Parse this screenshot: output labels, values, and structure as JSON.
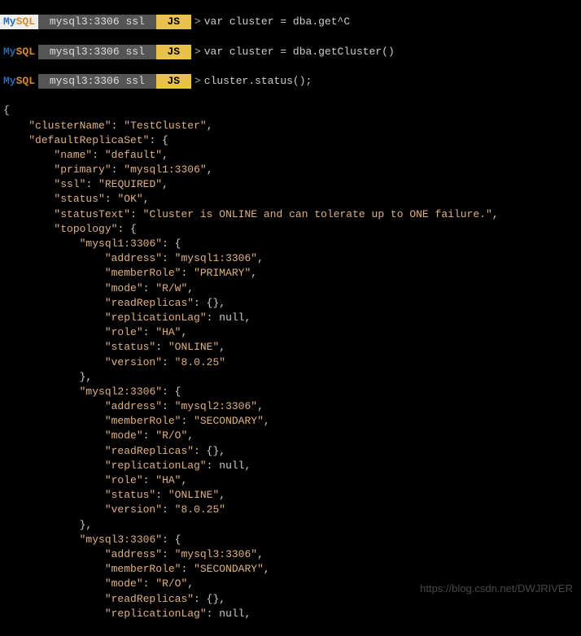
{
  "prompts": [
    {
      "host": "mysql3:3306 ssl",
      "lang": "JS",
      "cmd": "var cluster = dba.get^C",
      "mysqlBg": "white"
    },
    {
      "host": "mysql3:3306 ssl",
      "lang": "JS",
      "cmd": "var cluster = dba.getCluster()",
      "mysqlBg": "none"
    },
    {
      "host": "mysql3:3306 ssl",
      "lang": "JS",
      "cmd": "cluster.status();",
      "mysqlBg": "none"
    }
  ],
  "mysqlLabel": {
    "my": "My",
    "sql": "SQL"
  },
  "output": {
    "clusterName": "TestCluster",
    "defaultReplicaSet": {
      "name": "default",
      "primary": "mysql1:3306",
      "ssl": "REQUIRED",
      "status": "OK",
      "statusText": "Cluster is ONLINE and can tolerate up to ONE failure.",
      "topology": {
        "mysql1:3306": {
          "address": "mysql1:3306",
          "memberRole": "PRIMARY",
          "mode": "R/W",
          "readReplicas": "{}",
          "replicationLag": "null",
          "role": "HA",
          "status": "ONLINE",
          "version": "8.0.25"
        },
        "mysql2:3306": {
          "address": "mysql2:3306",
          "memberRole": "SECONDARY",
          "mode": "R/O",
          "readReplicas": "{}",
          "replicationLag": "null",
          "role": "HA",
          "status": "ONLINE",
          "version": "8.0.25"
        },
        "mysql3:3306": {
          "address": "mysql3:3306",
          "memberRole": "SECONDARY",
          "mode": "R/O",
          "readReplicas": "{}",
          "replicationLag": "null"
        }
      }
    }
  },
  "watermark": "https://blog.csdn.net/DWJRIVER"
}
